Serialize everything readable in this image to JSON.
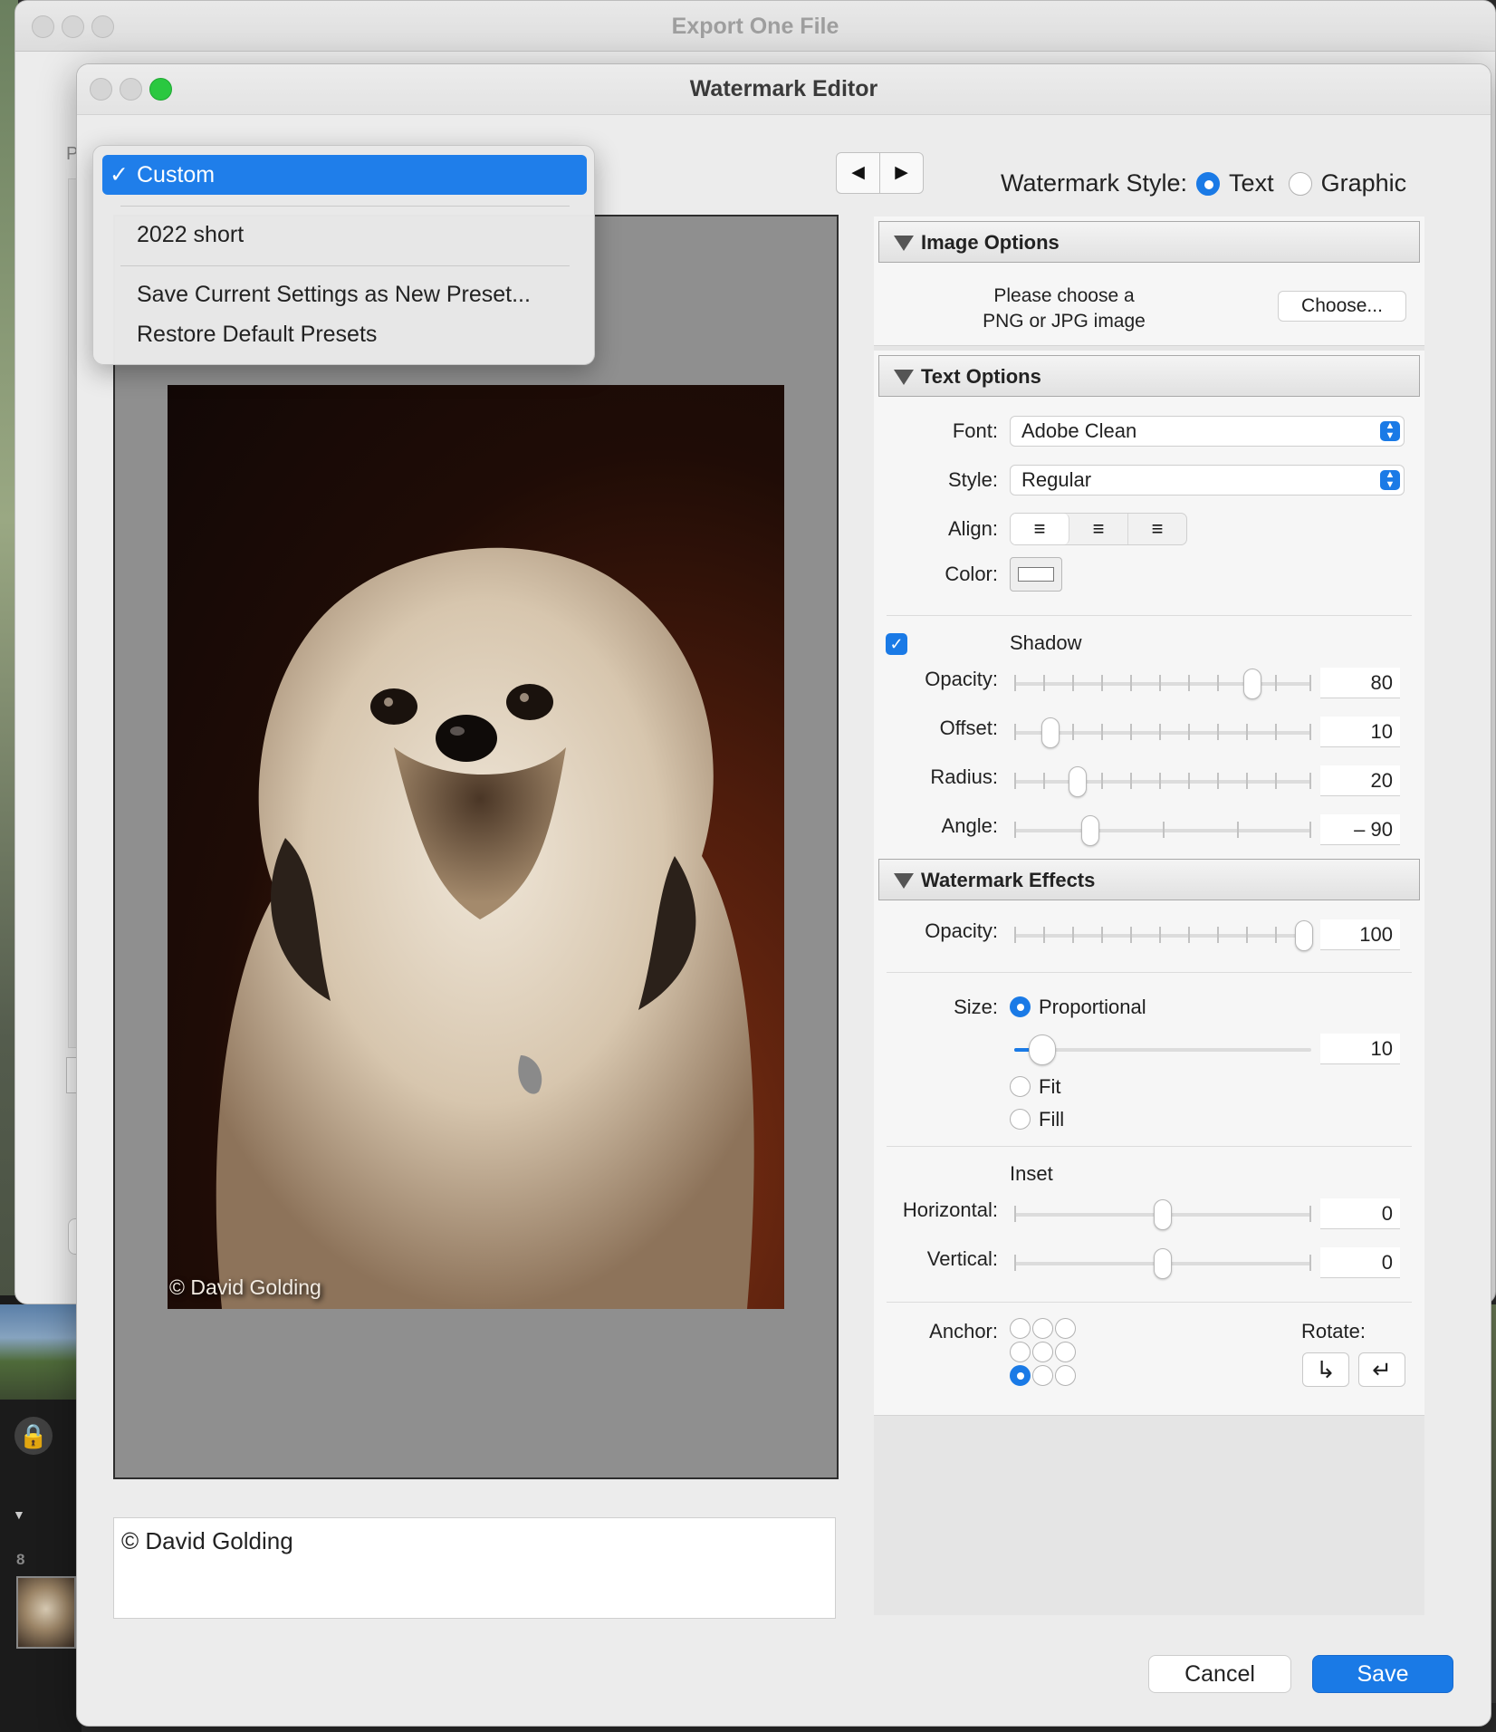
{
  "background": {
    "filmstrip_number": "8",
    "lock_icon": "lock-icon"
  },
  "back_window": {
    "title": "Export One File",
    "preset_label_fragment": "Pre",
    "button_fragment": "F"
  },
  "dialog": {
    "title": "Watermark Editor"
  },
  "preset_menu": {
    "items": [
      "Custom",
      "2022 short",
      "Save Current Settings as New Preset...",
      "Restore Default Presets"
    ],
    "checkmark": "✓"
  },
  "preview": {
    "watermark_overlay": "© David Golding"
  },
  "text_input": {
    "value": "© David Golding"
  },
  "nav": {
    "prev": "◀",
    "next": "▶"
  },
  "watermark_style": {
    "label": "Watermark Style:",
    "options": [
      "Text",
      "Graphic"
    ],
    "selected": "Text"
  },
  "image_options": {
    "header": "Image Options",
    "hint_line1": "Please choose a",
    "hint_line2": "PNG or JPG image",
    "choose_button": "Choose..."
  },
  "text_options": {
    "header": "Text Options",
    "font_label": "Font:",
    "font_value": "Adobe Clean",
    "style_label": "Style:",
    "style_value": "Regular",
    "align_label": "Align:",
    "align_selected": "left",
    "color_label": "Color:",
    "shadow_label": "Shadow",
    "shadow_checked": true,
    "opacity_label": "Opacity:",
    "opacity_value": "80",
    "offset_label": "Offset:",
    "offset_value": "10",
    "radius_label": "Radius:",
    "radius_value": "20",
    "angle_label": "Angle:",
    "angle_value": "– 90"
  },
  "watermark_effects": {
    "header": "Watermark Effects",
    "opacity_label": "Opacity:",
    "opacity_value": "100",
    "size_label": "Size:",
    "size_options": [
      "Proportional",
      "Fit",
      "Fill"
    ],
    "size_selected": "Proportional",
    "size_value": "10",
    "inset_label": "Inset",
    "horizontal_label": "Horizontal:",
    "horizontal_value": "0",
    "vertical_label": "Vertical:",
    "vertical_value": "0",
    "anchor_label": "Anchor:",
    "anchor_selected": "bottom-left",
    "rotate_label": "Rotate:"
  },
  "footer": {
    "cancel": "Cancel",
    "save": "Save"
  },
  "colors": {
    "accent": "#1a7ae6",
    "menu_highlight": "#1f7eea",
    "preview_bg": "#8f8f8f",
    "close_green": "#2ac840"
  }
}
